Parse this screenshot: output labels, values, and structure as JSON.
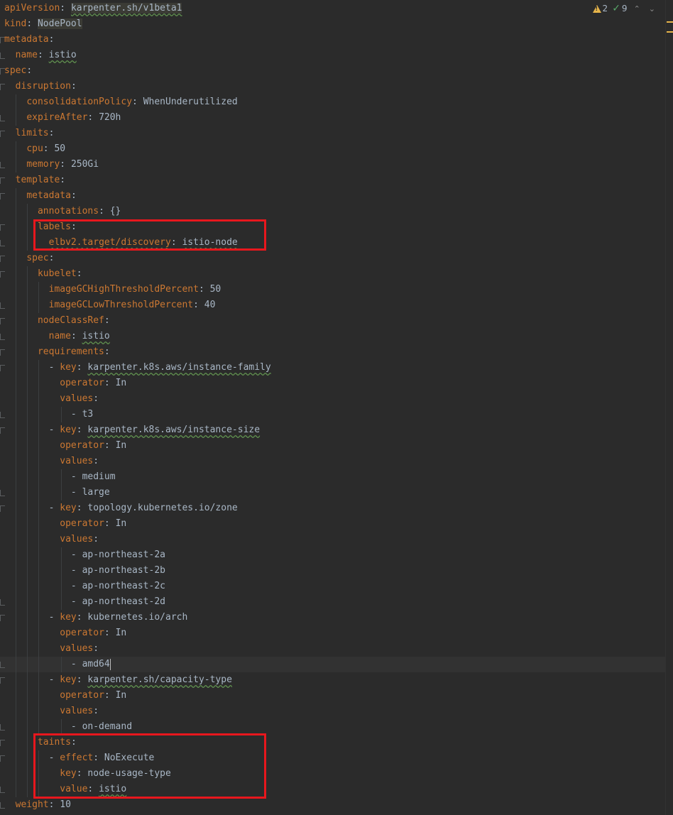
{
  "inspections": {
    "warnings_count": "2",
    "ok_count": "9",
    "warn_icon": "warning-triangle-icon",
    "ok_icon": "checkmark-icon",
    "prev_icon": "chevron-up-icon",
    "next_icon": "chevron-down-icon"
  },
  "colors": {
    "background": "#2b2b2b",
    "key": "#cc7832",
    "value": "#a9b7c6",
    "highlight_box": "#e8171d",
    "warning": "#e6b44a",
    "ok": "#59a869"
  },
  "lines": [
    {
      "indent": "",
      "key": "apiVersion",
      "value": "karpenter.sh/v1beta1"
    },
    {
      "indent": "",
      "key": "kind",
      "value": "NodePool"
    },
    {
      "indent": "",
      "key": "metadata",
      "value": ""
    },
    {
      "indent": "  ",
      "key": "name",
      "value": "istio"
    },
    {
      "indent": "",
      "key": "spec",
      "value": ""
    },
    {
      "indent": "  ",
      "key": "disruption",
      "value": ""
    },
    {
      "indent": "    ",
      "key": "consolidationPolicy",
      "value": "WhenUnderutilized"
    },
    {
      "indent": "    ",
      "key": "expireAfter",
      "value": "720h"
    },
    {
      "indent": "  ",
      "key": "limits",
      "value": ""
    },
    {
      "indent": "    ",
      "key": "cpu",
      "value": "50"
    },
    {
      "indent": "    ",
      "key": "memory",
      "value": "250Gi"
    },
    {
      "indent": "  ",
      "key": "template",
      "value": ""
    },
    {
      "indent": "    ",
      "key": "metadata",
      "value": ""
    },
    {
      "indent": "      ",
      "key": "annotations",
      "value": "{}"
    },
    {
      "indent": "      ",
      "key": "labels",
      "value": ""
    },
    {
      "indent": "        ",
      "key": "elbv2.target/discovery",
      "value": "istio-node"
    },
    {
      "indent": "    ",
      "key": "spec",
      "value": ""
    },
    {
      "indent": "      ",
      "key": "kubelet",
      "value": ""
    },
    {
      "indent": "        ",
      "key": "imageGCHighThresholdPercent",
      "value": "50"
    },
    {
      "indent": "        ",
      "key": "imageGCLowThresholdPercent",
      "value": "40"
    },
    {
      "indent": "      ",
      "key": "nodeClassRef",
      "value": ""
    },
    {
      "indent": "        ",
      "key": "name",
      "value": "istio"
    },
    {
      "indent": "      ",
      "key": "requirements",
      "value": ""
    },
    {
      "indent": "        - ",
      "key": "key",
      "value": "karpenter.k8s.aws/instance-family"
    },
    {
      "indent": "          ",
      "key": "operator",
      "value": "In"
    },
    {
      "indent": "          ",
      "key": "values",
      "value": ""
    },
    {
      "indent": "            - ",
      "key": "",
      "value": "t3"
    },
    {
      "indent": "        - ",
      "key": "key",
      "value": "karpenter.k8s.aws/instance-size"
    },
    {
      "indent": "          ",
      "key": "operator",
      "value": "In"
    },
    {
      "indent": "          ",
      "key": "values",
      "value": ""
    },
    {
      "indent": "            - ",
      "key": "",
      "value": "medium"
    },
    {
      "indent": "            - ",
      "key": "",
      "value": "large"
    },
    {
      "indent": "        - ",
      "key": "key",
      "value": "topology.kubernetes.io/zone"
    },
    {
      "indent": "          ",
      "key": "operator",
      "value": "In"
    },
    {
      "indent": "          ",
      "key": "values",
      "value": ""
    },
    {
      "indent": "            - ",
      "key": "",
      "value": "ap-northeast-2a"
    },
    {
      "indent": "            - ",
      "key": "",
      "value": "ap-northeast-2b"
    },
    {
      "indent": "            - ",
      "key": "",
      "value": "ap-northeast-2c"
    },
    {
      "indent": "            - ",
      "key": "",
      "value": "ap-northeast-2d"
    },
    {
      "indent": "        - ",
      "key": "key",
      "value": "kubernetes.io/arch"
    },
    {
      "indent": "          ",
      "key": "operator",
      "value": "In"
    },
    {
      "indent": "          ",
      "key": "values",
      "value": ""
    },
    {
      "indent": "            - ",
      "key": "",
      "value": "amd64"
    },
    {
      "indent": "        - ",
      "key": "key",
      "value": "karpenter.sh/capacity-type"
    },
    {
      "indent": "          ",
      "key": "operator",
      "value": "In"
    },
    {
      "indent": "          ",
      "key": "values",
      "value": ""
    },
    {
      "indent": "            - ",
      "key": "",
      "value": "on-demand"
    },
    {
      "indent": "      ",
      "key": "taints",
      "value": ""
    },
    {
      "indent": "        - ",
      "key": "effect",
      "value": "NoExecute"
    },
    {
      "indent": "          ",
      "key": "key",
      "value": "node-usage-type"
    },
    {
      "indent": "          ",
      "key": "value",
      "value": "istio"
    },
    {
      "indent": "  ",
      "key": "weight",
      "value": "10"
    }
  ]
}
